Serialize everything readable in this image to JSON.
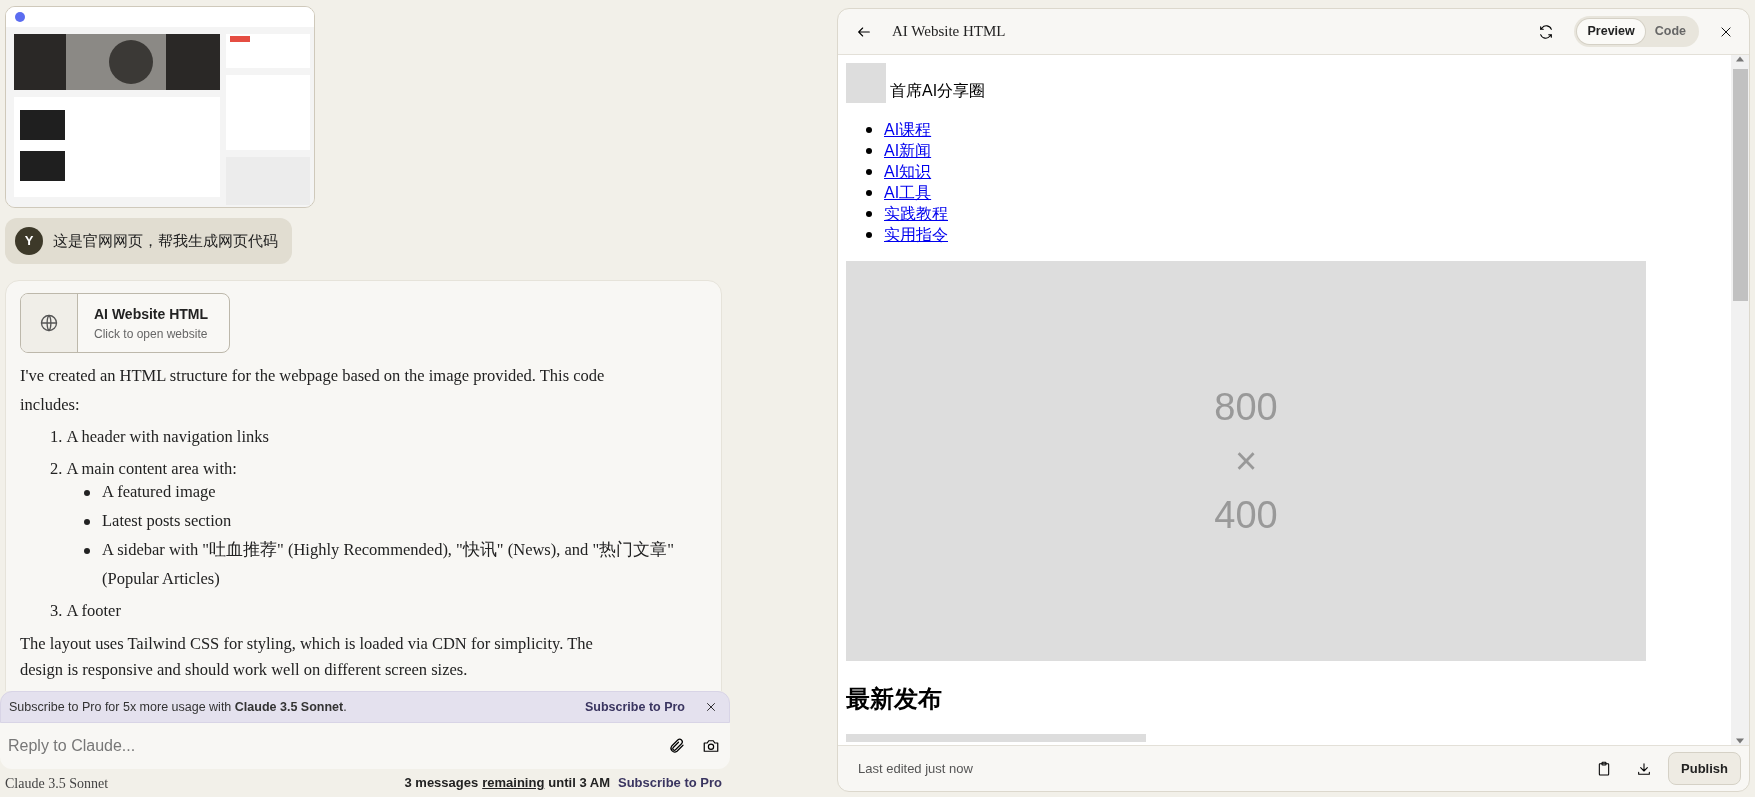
{
  "user_message": {
    "avatar": "Y",
    "text": "这是官网网页，帮我生成网页代码"
  },
  "assistant_message": {
    "artifact": {
      "title": "AI Website HTML",
      "subtitle": "Click to open website"
    },
    "intro": "I've created an HTML structure for the webpage based on the image provided. This code includes:",
    "points": [
      {
        "number": "1.",
        "text": "A header with navigation links"
      },
      {
        "number": "2.",
        "text": "A main content area with:",
        "children": [
          {
            "text": "A featured image"
          },
          {
            "text": "Latest posts section"
          },
          {
            "text": "A sidebar with \"吐血推荐\" (Highly Recommended), \"快讯\" (News), and \"热门文章\" (Popular Articles)"
          }
        ]
      },
      {
        "number": "3.",
        "text": "A footer"
      }
    ],
    "closing": "The layout uses Tailwind CSS for styling, which is loaded via CDN for simplicity. The design is responsive and should work well on different screen sizes."
  },
  "upgrade_banner": {
    "text": "Subscribe to Pro for 5x more usage with **Claude 3.5 Sonnet**.",
    "link": "Subscribe to Pro"
  },
  "composer": {
    "placeholder": "Reply to Claude..."
  },
  "footer": {
    "model": "Claude 3.5 Sonnet",
    "usage_start": "3 messages",
    "usage_link": "remaining",
    "usage_end": "until 3 AM",
    "subscribe": "Subscribe to Pro"
  },
  "preview_panel": {
    "title": "AI Website HTML",
    "tabs": [
      {
        "label": "Preview",
        "selected": true
      },
      {
        "label": "Code",
        "selected": false
      }
    ],
    "site": {
      "name": "首席AI分享圈",
      "nav": [
        "AI课程",
        "AI新闻",
        "AI知识",
        "AI工具",
        "实践教程",
        "实用指令"
      ],
      "hero_text": "800 × 400",
      "section_heading": "最新发布"
    },
    "status": "Last edited just now",
    "publish": "Publish"
  }
}
